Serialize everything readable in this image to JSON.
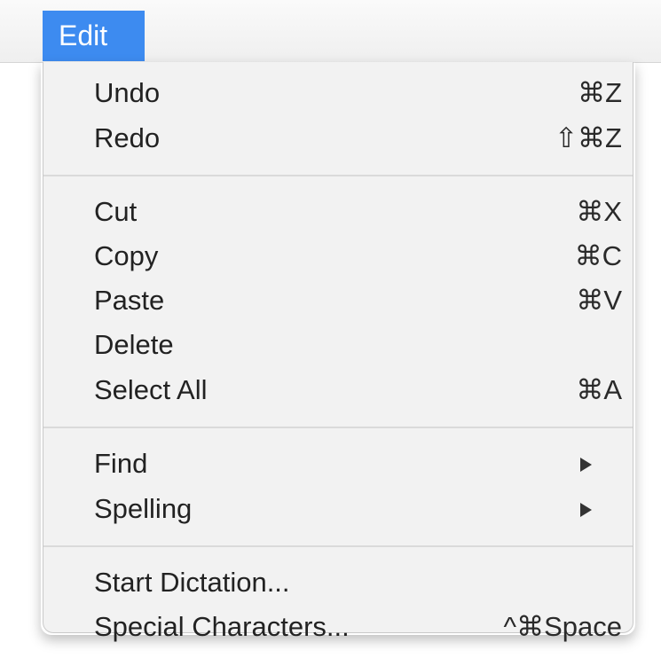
{
  "menubar": {
    "title": "Edit"
  },
  "menu": {
    "groups": [
      [
        {
          "label": "Undo",
          "shortcut": "⌘Z"
        },
        {
          "label": "Redo",
          "shortcut": "⇧⌘Z"
        }
      ],
      [
        {
          "label": "Cut",
          "shortcut": "⌘X"
        },
        {
          "label": "Copy",
          "shortcut": "⌘C"
        },
        {
          "label": "Paste",
          "shortcut": "⌘V"
        },
        {
          "label": "Delete",
          "shortcut": ""
        },
        {
          "label": "Select All",
          "shortcut": "⌘A"
        }
      ],
      [
        {
          "label": "Find",
          "submenu_icon": "triangle-right-icon"
        },
        {
          "label": "Spelling",
          "submenu_icon": "triangle-right-icon"
        }
      ],
      [
        {
          "label": "Start Dictation...",
          "shortcut": ""
        },
        {
          "label": "Special Characters...",
          "shortcut": "^⌘Space"
        }
      ]
    ]
  },
  "colors": {
    "highlight": "#3d8bf0",
    "menu_background": "#f2f2f2",
    "text": "#222222"
  }
}
